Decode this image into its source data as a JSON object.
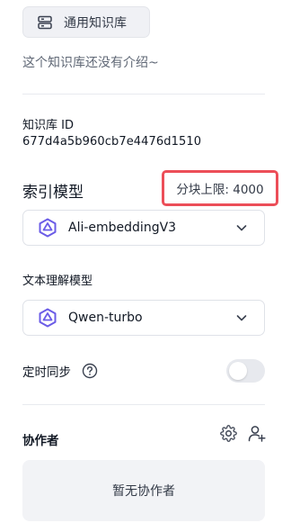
{
  "kb": {
    "type_label": "通用知识库",
    "intro": "这个知识库还没有介绍~",
    "id_label": "知识库 ID",
    "id_value": "677d4a5b960cb7e4476d1510"
  },
  "index_model": {
    "title": "索引模型",
    "chunk_limit": "分块上限: 4000",
    "selected": "Ali-embeddingV3"
  },
  "text_model": {
    "title": "文本理解模型",
    "selected": "Qwen-turbo"
  },
  "sync": {
    "label": "定时同步",
    "enabled": false
  },
  "collaborators": {
    "title": "协作者",
    "empty_text": "暂无协作者"
  },
  "icons": {
    "kb_type": "database-icon",
    "model": "model-logo-icon",
    "dropdown": "chevron-down-icon",
    "help": "help-circle-icon",
    "settings": "gear-icon",
    "add_user": "add-user-icon"
  },
  "colors": {
    "accent_purple": "#6b5ce7",
    "highlight_red": "#ec4e58",
    "toggle_off": "#e7e9ee"
  }
}
